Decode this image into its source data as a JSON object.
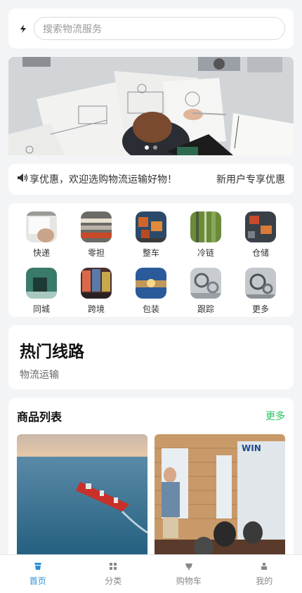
{
  "search": {
    "placeholder": "搜索物流服务"
  },
  "banner": {
    "dots": 2,
    "active_dot": 1
  },
  "notice": {
    "text": "享优惠，欢迎选购物流运输好物！",
    "right": "新用户专享优惠"
  },
  "categories": [
    {
      "label": "快递",
      "icon": "express-image"
    },
    {
      "label": "零担",
      "icon": "ltl-image"
    },
    {
      "label": "整车",
      "icon": "ftl-image"
    },
    {
      "label": "冷链",
      "icon": "cold-chain-image"
    },
    {
      "label": "仓储",
      "icon": "warehouse-image"
    },
    {
      "label": "同城",
      "icon": "same-city-image"
    },
    {
      "label": "跨境",
      "icon": "cross-border-image"
    },
    {
      "label": "包装",
      "icon": "packaging-image"
    },
    {
      "label": "跟踪",
      "icon": "tracking-image"
    },
    {
      "label": "更多",
      "icon": "more-image"
    }
  ],
  "hot": {
    "title": "热门线路",
    "subtitle": "物流运输"
  },
  "products": {
    "title": "商品列表",
    "more": "更多"
  },
  "tabs": [
    {
      "label": "首页",
      "icon": "home-icon",
      "active": true
    },
    {
      "label": "分类",
      "icon": "grid-icon",
      "active": false
    },
    {
      "label": "购物车",
      "icon": "cart-icon",
      "active": false
    },
    {
      "label": "我的",
      "icon": "user-icon",
      "active": false
    }
  ],
  "colors": {
    "accent": "#2b8fd6",
    "more": "#22c55e"
  }
}
